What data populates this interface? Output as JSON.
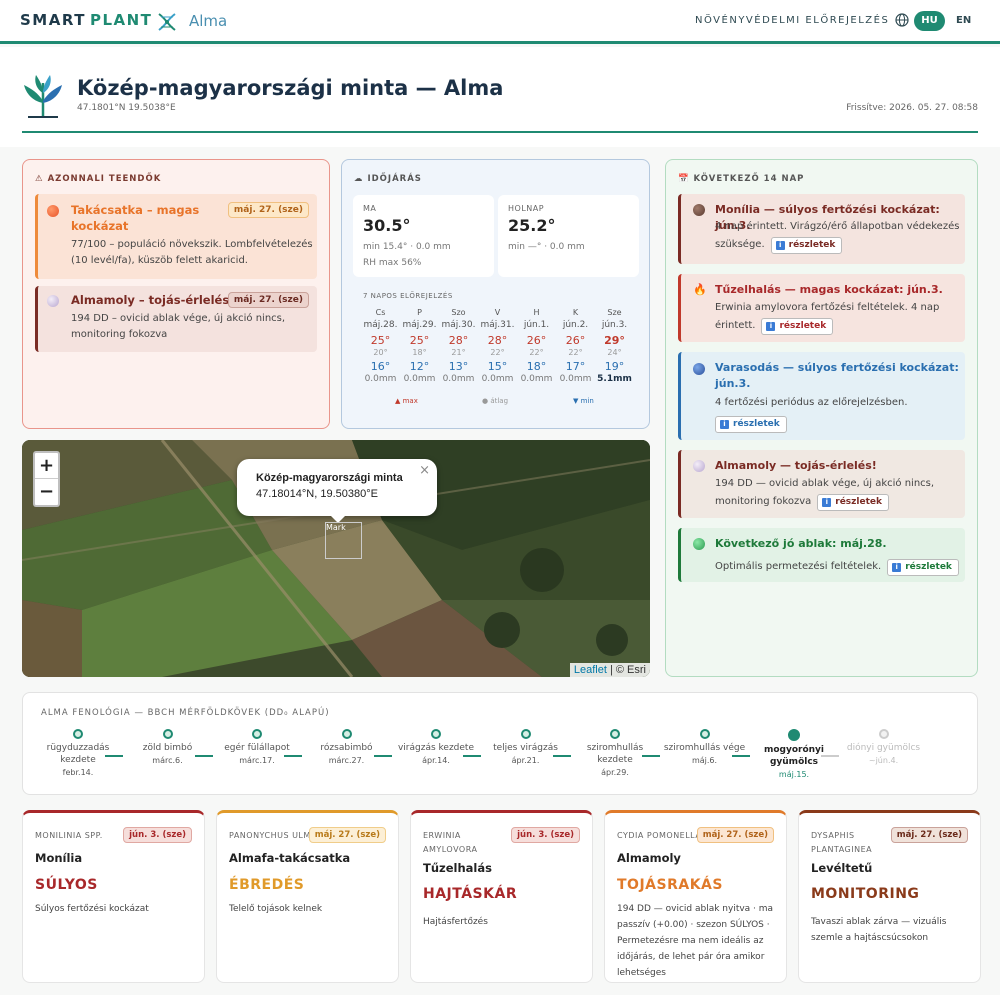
{
  "topbar": {
    "brand1": "SMART",
    "brand2": "PLANT",
    "crop": "Alma",
    "nav_title": "NÖVÉNYVÉDELMI ELŐREJELZÉS",
    "lang_hu": "HU",
    "lang_en": "EN",
    "accent": "#1f8a72"
  },
  "header": {
    "title": "Közép-magyarországi minta — Alma",
    "coords": "47.1801°N 19.5038°E",
    "updated": "Frissítve: 2026. 05. 27. 08:58"
  },
  "alerts": {
    "title": "⚠ AZONNALI TEENDŐK",
    "items": [
      {
        "title": "Takácsatka – magas kockázat",
        "date": "máj. 27. (sze)",
        "desc": "77/100 – populáció növekszik. Lombfelvételezés (10 levél/fa), küszöb felett akaricid.",
        "color": "#e8742a"
      },
      {
        "title": "Almamoly – tojás-érlelés",
        "date": "máj. 27. (sze)",
        "desc": "194 DD – ovicid ablak vége, új akció nincs, monitoring fokozva",
        "color": "#7a2b24"
      }
    ]
  },
  "weather": {
    "title": "☁ IDŐJÁRÁS",
    "today": {
      "label": "MA",
      "temp": "30.5°",
      "sub": "min 15.4° · 0.0 mm",
      "sub2": "RH max 56%"
    },
    "tomorrow": {
      "label": "HOLNAP",
      "temp": "25.2°",
      "sub": "min —° · 0.0 mm"
    },
    "forecast_title": "7 NAPOS ELŐREJELZÉS",
    "forecast": [
      {
        "day": "Cs",
        "date": "máj.28.",
        "max": "25°",
        "hum": "20°",
        "min": "16°",
        "rain": "0.0mm"
      },
      {
        "day": "P",
        "date": "máj.29.",
        "max": "25°",
        "hum": "18°",
        "min": "12°",
        "rain": "0.0mm"
      },
      {
        "day": "Szo",
        "date": "máj.30.",
        "max": "28°",
        "hum": "21°",
        "min": "13°",
        "rain": "0.0mm"
      },
      {
        "day": "V",
        "date": "máj.31.",
        "max": "28°",
        "hum": "22°",
        "min": "15°",
        "rain": "0.0mm"
      },
      {
        "day": "H",
        "date": "jún.1.",
        "max": "26°",
        "hum": "22°",
        "min": "18°",
        "rain": "0.0mm"
      },
      {
        "day": "K",
        "date": "jún.2.",
        "max": "26°",
        "hum": "22°",
        "min": "17°",
        "rain": "0.0mm"
      },
      {
        "day": "Sze",
        "date": "jún.3.",
        "max": "29°",
        "hum": "24°",
        "min": "19°",
        "rain": "5.1mm"
      }
    ],
    "legend_max": "▲ max",
    "legend_avg": "● átlag",
    "legend_min": "▼ min"
  },
  "map": {
    "zoom_in": "+",
    "zoom_out": "−",
    "popup_title": "Közép-magyarországi minta",
    "popup_coords": "47.18014°N, 19.50380°E",
    "popup_close": "×",
    "marker_alt": "Mark",
    "attrib_leaflet": "Leaflet",
    "attrib_rest": " | © Esri"
  },
  "next14": {
    "title": "📅 KÖVETKEZŐ 14 NAP",
    "btn_label": "részletek",
    "items": [
      {
        "title": "Monília — súlyos fertőzési kockázat: jún.3.",
        "desc": "4 nap érintett. Virágzó/érő állapotban védekezés szüksége.",
        "color": "#7a2b24"
      },
      {
        "title": "Tűzelhalás — magas kockázat: jún.3.",
        "desc": "Erwinia amylovora fertőzési feltételek. 4 nap érintett.",
        "color": "#c0392b"
      },
      {
        "title": "Varasodás — súlyos fertőzési kockázat: jún.3.",
        "desc": "4 fertőzési periódus az előrejelzésben.",
        "color": "#2a6fb0"
      },
      {
        "title": "Almamoly — tojás-érlelés!",
        "desc": "194 DD — ovicid ablak vége, új akció nincs, monitoring fokozva",
        "color": "#7a2b24"
      },
      {
        "title": "Következő jó ablak: máj.28.",
        "desc": "Optimális permetezési feltételek.",
        "color": "#1e7a3a"
      }
    ]
  },
  "pheno": {
    "title": "ALMA FENOLÓGIA — BBCH MÉRFÖLDKÖVEK (DD₀ ALAPÚ)",
    "stages": [
      {
        "name": "rügyduzzadás kezdete",
        "date": "febr.14."
      },
      {
        "name": "zöld bimbó",
        "date": "márc.6."
      },
      {
        "name": "egér fülállapot",
        "date": "márc.17."
      },
      {
        "name": "rózsabimbó",
        "date": "márc.27."
      },
      {
        "name": "virágzás kezdete",
        "date": "ápr.14."
      },
      {
        "name": "teljes virágzás",
        "date": "ápr.21."
      },
      {
        "name": "sziromhullás kezdete",
        "date": "ápr.29."
      },
      {
        "name": "sziromhullás vége",
        "date": "máj.6."
      },
      {
        "name": "mogyorónyi gyümölcs",
        "date": "máj.15."
      },
      {
        "name": "diónyi gyümölcs",
        "date": "~jún.4."
      }
    ]
  },
  "pests": [
    {
      "latin": "MONILINIA SPP.",
      "date": "jún. 3. (sze)",
      "name": "Monília",
      "status": "SÚLYOS",
      "desc": "Súlyos fertőzési kockázat",
      "color": "#a8282a"
    },
    {
      "latin": "PANONYCHUS ULMI",
      "date": "máj. 27. (sze)",
      "name": "Almafa-takácsatka",
      "status": "ÉBREDÉS",
      "desc": "Telelő tojások kelnek",
      "color": "#e09a2a"
    },
    {
      "latin": "ERWINIA AMYLOVORA",
      "date": "jún. 3. (sze)",
      "name": "Tűzelhalás",
      "status": "HAJTÁSKÁR",
      "desc": "Hajtásfertőzés",
      "color": "#a8282a"
    },
    {
      "latin": "CYDIA POMONELLA",
      "date": "máj. 27. (sze)",
      "name": "Almamoly",
      "status": "TOJÁSRAKÁS",
      "desc": "194 DD — ovicid ablak nyitva · ma passzív (+0.00) · szezon SÚLYOS · Permetezésre ma nem ideális az időjárás, de lehet pár óra amikor lehetséges",
      "color": "#e07a2a"
    },
    {
      "latin": "DYSAPHIS PLANTAGINEA",
      "date": "máj. 27. (sze)",
      "name": "Levéltetű",
      "status": "MONITORING",
      "desc": "Tavaszi ablak zárva — vizuális szemle a hajtáscsúcsokon",
      "color": "#8a3a1a"
    }
  ]
}
